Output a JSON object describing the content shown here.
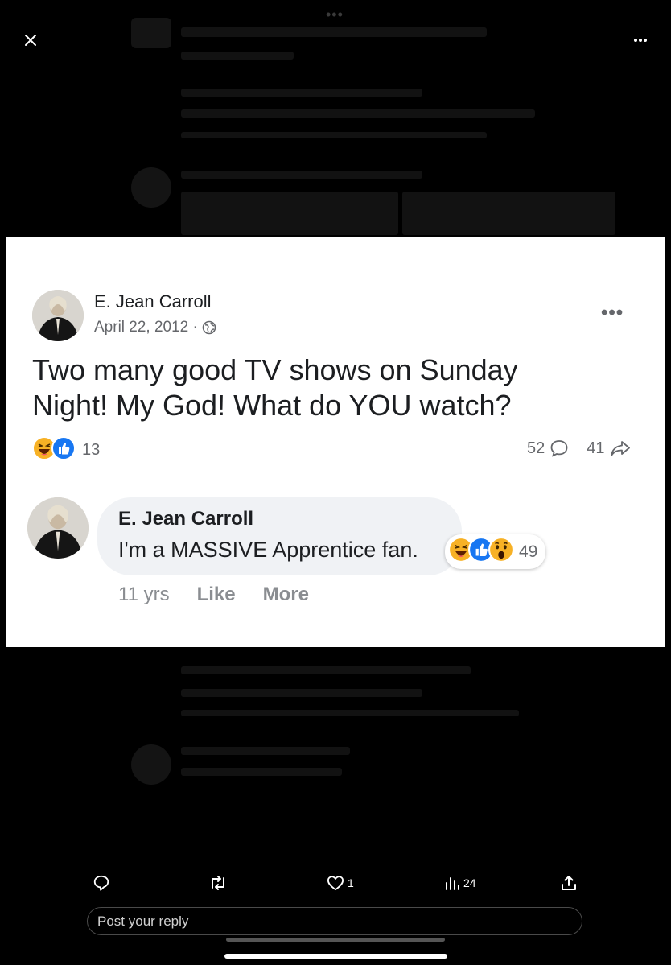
{
  "viewer": {
    "more_dots": "•••"
  },
  "post": {
    "author": "E. Jean Carroll",
    "date": "April 22, 2012 ·",
    "more": "•••",
    "text": "Two many good TV shows on Sunday Night! My God! What do YOU watch?",
    "reaction_count": "13",
    "comment_count": "52",
    "share_count": "41"
  },
  "comment": {
    "author": "E. Jean Carroll",
    "text": "I'm a MASSIVE Apprentice fan.",
    "reaction_count": "49",
    "age": "11 yrs",
    "like_label": "Like",
    "more_label": "More"
  },
  "actions": {
    "like_count": "1",
    "views_count": "24"
  },
  "reply": {
    "placeholder": "Post your reply"
  },
  "colors": {
    "like_blue": "#1877f2",
    "haha_yellow": "#f7b125",
    "meta_gray": "#65676b"
  },
  "icons": [
    "close-icon",
    "more-icon",
    "globe-icon",
    "haha-emoji-icon",
    "like-emoji-icon",
    "wow-emoji-icon",
    "comment-icon",
    "share-icon",
    "reply-icon",
    "retweet-icon",
    "heart-icon",
    "views-icon",
    "upload-icon"
  ]
}
